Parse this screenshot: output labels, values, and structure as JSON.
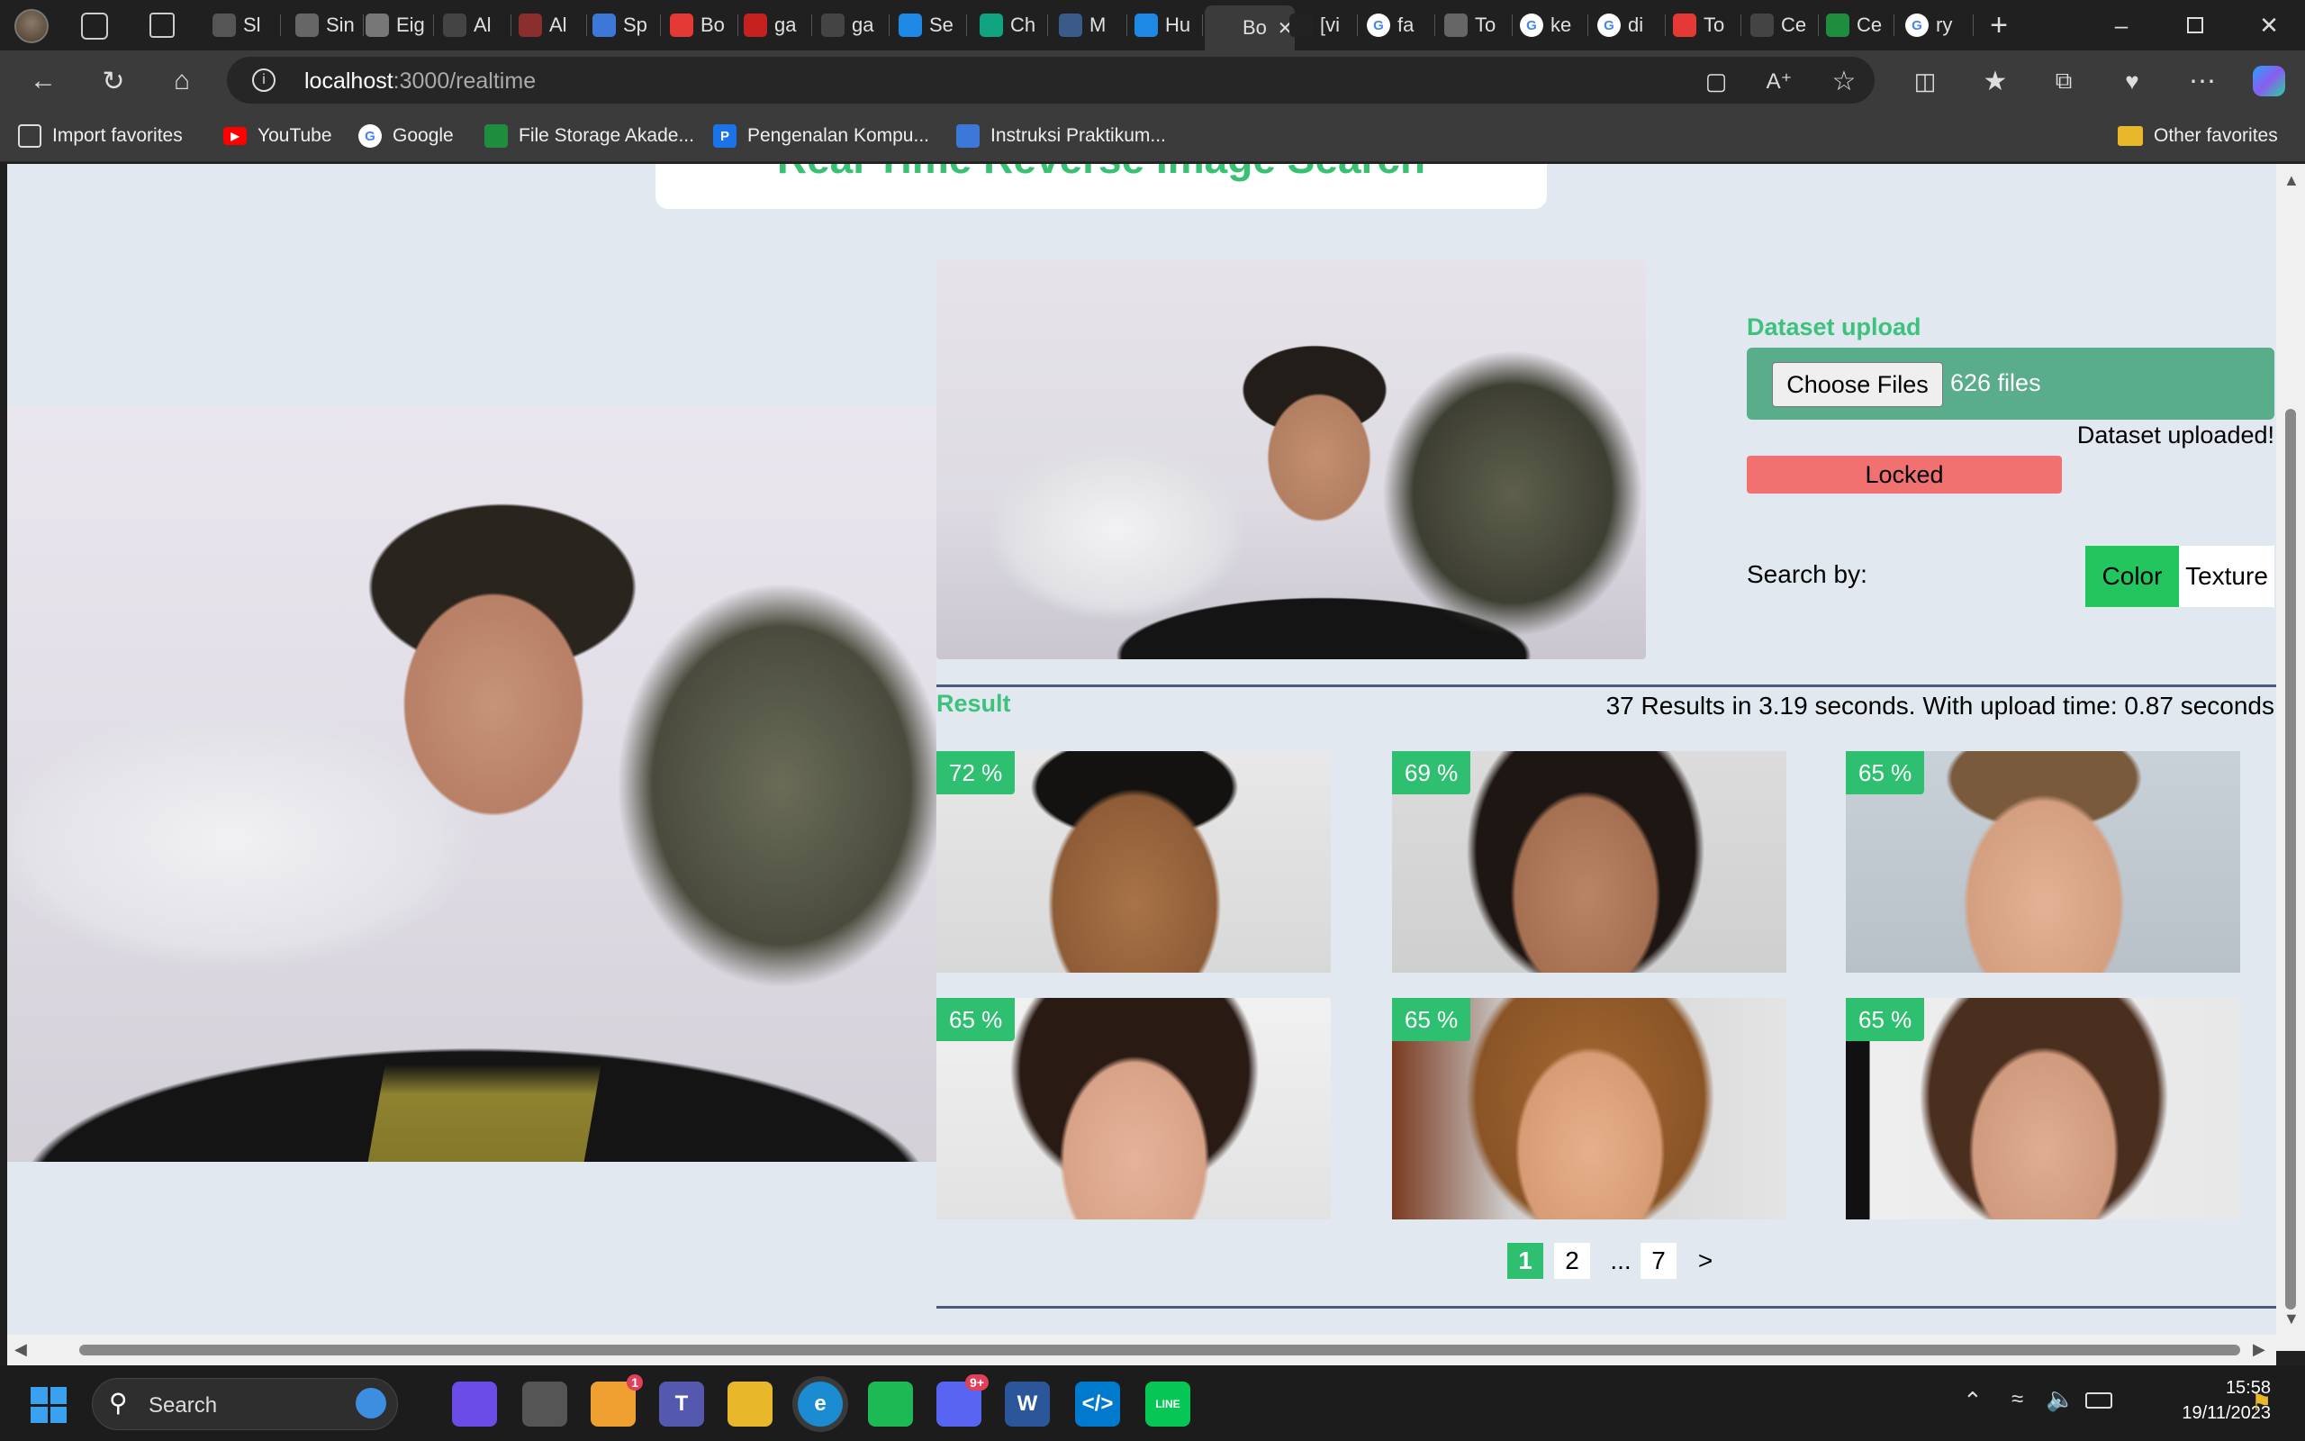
{
  "tabs": [
    {
      "label": "Sl",
      "icon": "image-icon",
      "color": "#555"
    },
    {
      "label": "Sin",
      "icon": "doc-icon",
      "color": "#666"
    },
    {
      "label": "Eig",
      "icon": "wikipedia-icon",
      "color": "#777"
    },
    {
      "label": "Al",
      "icon": "github-icon",
      "color": "#444"
    },
    {
      "label": "Al",
      "icon": "database-icon",
      "color": "#8b2e2e"
    },
    {
      "label": "Sp",
      "icon": "google-docs-icon",
      "color": "#3c78d8"
    },
    {
      "label": "Bo",
      "icon": "record-icon",
      "color": "#e53935"
    },
    {
      "label": "ga",
      "icon": "gmail-icon",
      "color": "#c5221f"
    },
    {
      "label": "ga",
      "icon": "github-icon",
      "color": "#444"
    },
    {
      "label": "Se",
      "icon": "k-icon",
      "color": "#1e88e5"
    },
    {
      "label": "Ch",
      "icon": "chatgpt-icon",
      "color": "#10a37f"
    },
    {
      "label": "M",
      "icon": "app-icon",
      "color": "#3a5a8a"
    },
    {
      "label": "Hu",
      "icon": "k-icon",
      "color": "#1e88e5"
    },
    {
      "label": "Bo",
      "icon": "active-tab-icon",
      "color": "#3b3b3b",
      "active": true
    },
    {
      "label": "[vi",
      "icon": "sf-icon",
      "color": "#222"
    },
    {
      "label": "fa",
      "icon": "google-icon",
      "color": "#fff"
    },
    {
      "label": "To",
      "icon": "doc-icon",
      "color": "#666"
    },
    {
      "label": "ke",
      "icon": "google-icon",
      "color": "#fff"
    },
    {
      "label": "di",
      "icon": "google-icon",
      "color": "#fff"
    },
    {
      "label": "To",
      "icon": "flame-icon",
      "color": "#e53935"
    },
    {
      "label": "Ce",
      "icon": "app-icon",
      "color": "#444"
    },
    {
      "label": "Ce",
      "icon": "drive-icon",
      "color": "#1e8e3e"
    },
    {
      "label": "ry",
      "icon": "google-icon",
      "color": "#fff"
    }
  ],
  "address": {
    "host": "localhost",
    "path": ":3000/realtime"
  },
  "bookmarks": [
    {
      "label": "Import favorites",
      "icon": "import-icon",
      "color": "#3b3b3b"
    },
    {
      "label": "YouTube",
      "icon": "youtube-icon",
      "color": "#ff0000"
    },
    {
      "label": "Google",
      "icon": "google-icon",
      "color": "#ffffff"
    },
    {
      "label": "File Storage Akade...",
      "icon": "drive-icon",
      "color": "#1e8e3e"
    },
    {
      "label": "Pengenalan Kompu...",
      "icon": "p-icon",
      "color": "#1a73e8"
    },
    {
      "label": "Instruksi Praktikum...",
      "icon": "docs-icon",
      "color": "#3c78d8"
    }
  ],
  "other_favorites": "Other favorites",
  "page": {
    "title": "Real Time Reverse Image Search",
    "dataset_label": "Dataset upload",
    "choose_files": "Choose Files",
    "files_count": "626 files",
    "dataset_status": "Dataset uploaded!",
    "locked": "Locked",
    "search_by": "Search by:",
    "option_color": "Color",
    "option_texture": "Texture",
    "result_label": "Result",
    "result_summary": "37 Results in 3.19 seconds. With upload time: 0.87 seconds",
    "results": [
      {
        "percent": "72 %",
        "kind": "man-dark"
      },
      {
        "percent": "69 %",
        "kind": "woman-dark"
      },
      {
        "percent": "65 %",
        "kind": "man-light"
      },
      {
        "percent": "65 %",
        "kind": "woman-bangs"
      },
      {
        "percent": "65 %",
        "kind": "woman-light"
      },
      {
        "percent": "65 %",
        "kind": "woman-brown"
      }
    ],
    "pagination": [
      "1",
      "2",
      "...",
      "7",
      ">"
    ]
  },
  "taskbar": {
    "search": "Search",
    "time": "15:58",
    "date": "19/11/2023",
    "apps": [
      {
        "name": "copilot-icon",
        "color": "#6b4ce6",
        "label": ""
      },
      {
        "name": "task-view-icon",
        "color": "#555",
        "label": ""
      },
      {
        "name": "weather-icon",
        "color": "#f0a030",
        "label": "",
        "badge": "1"
      },
      {
        "name": "teams-icon",
        "color": "#5558af",
        "label": "T"
      },
      {
        "name": "explorer-icon",
        "color": "#e8b82a",
        "label": ""
      },
      {
        "name": "edge-icon",
        "color": "#1b8bd2",
        "label": "e"
      },
      {
        "name": "spotify-icon",
        "color": "#1db954",
        "label": ""
      },
      {
        "name": "discord-icon",
        "color": "#5865f2",
        "label": "",
        "badge": "9+"
      },
      {
        "name": "word-icon",
        "color": "#2b579a",
        "label": "W"
      },
      {
        "name": "vscode-icon",
        "color": "#007acc",
        "label": "&lt;/&gt;"
      },
      {
        "name": "line-icon",
        "color": "#06c755",
        "label": "LINE"
      }
    ]
  }
}
